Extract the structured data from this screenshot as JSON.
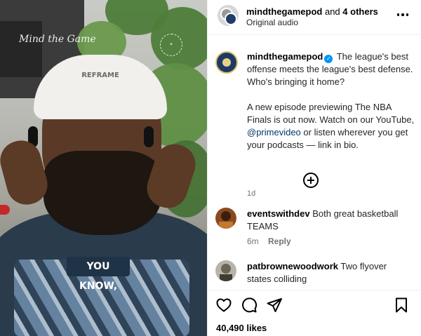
{
  "video": {
    "watermark": "Mind the Game",
    "cap_text": "REFRAME",
    "caption": "YOU KNOW,"
  },
  "header": {
    "username": "mindthegamepod",
    "and_text": "and",
    "others": "4 others",
    "subtitle": "Original audio"
  },
  "post": {
    "username": "mindthegamepod",
    "text_1": "The league's best offense meets the league's best defense. Who's bringing it home?",
    "text_2_before": "A new episode previewing The NBA Finals is out now. Watch on our YouTube,",
    "mention": "@primevideo",
    "text_2_after": "or listen wherever you get your podcasts — link in bio.",
    "time": "1d"
  },
  "comments": [
    {
      "username": "eventswithdev",
      "text": "Both great basketball TEAMS",
      "time": "6m",
      "reply": "Reply"
    },
    {
      "username": "patbrownewoodwork",
      "text": "Two flyover states colliding"
    }
  ],
  "footer": {
    "likes": "40,490 likes"
  },
  "icons": {
    "more": "more-options-icon",
    "verified": "verified-badge-icon",
    "load_more": "plus-circle-icon",
    "like": "heart-icon",
    "comment": "comment-icon",
    "share": "send-icon",
    "save": "bookmark-icon"
  },
  "colors": {
    "verified": "#0095f6",
    "mention": "#00376b",
    "meta": "#737373",
    "caption_bg": "#1f3347"
  }
}
